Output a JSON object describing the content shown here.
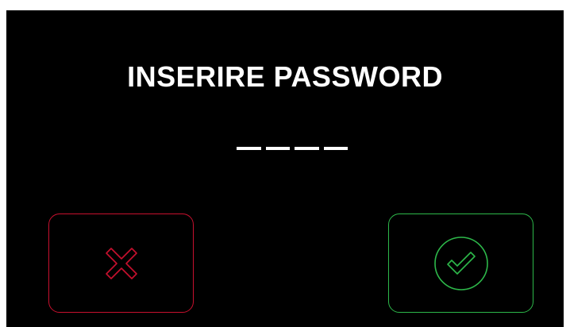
{
  "screen": {
    "title": "INSERIRE PASSWORD",
    "pin_slots": 4
  },
  "buttons": {
    "cancel": {
      "icon": "close-icon",
      "color": "#c8102e"
    },
    "confirm": {
      "icon": "check-circle-icon",
      "color": "#2db84a"
    }
  }
}
